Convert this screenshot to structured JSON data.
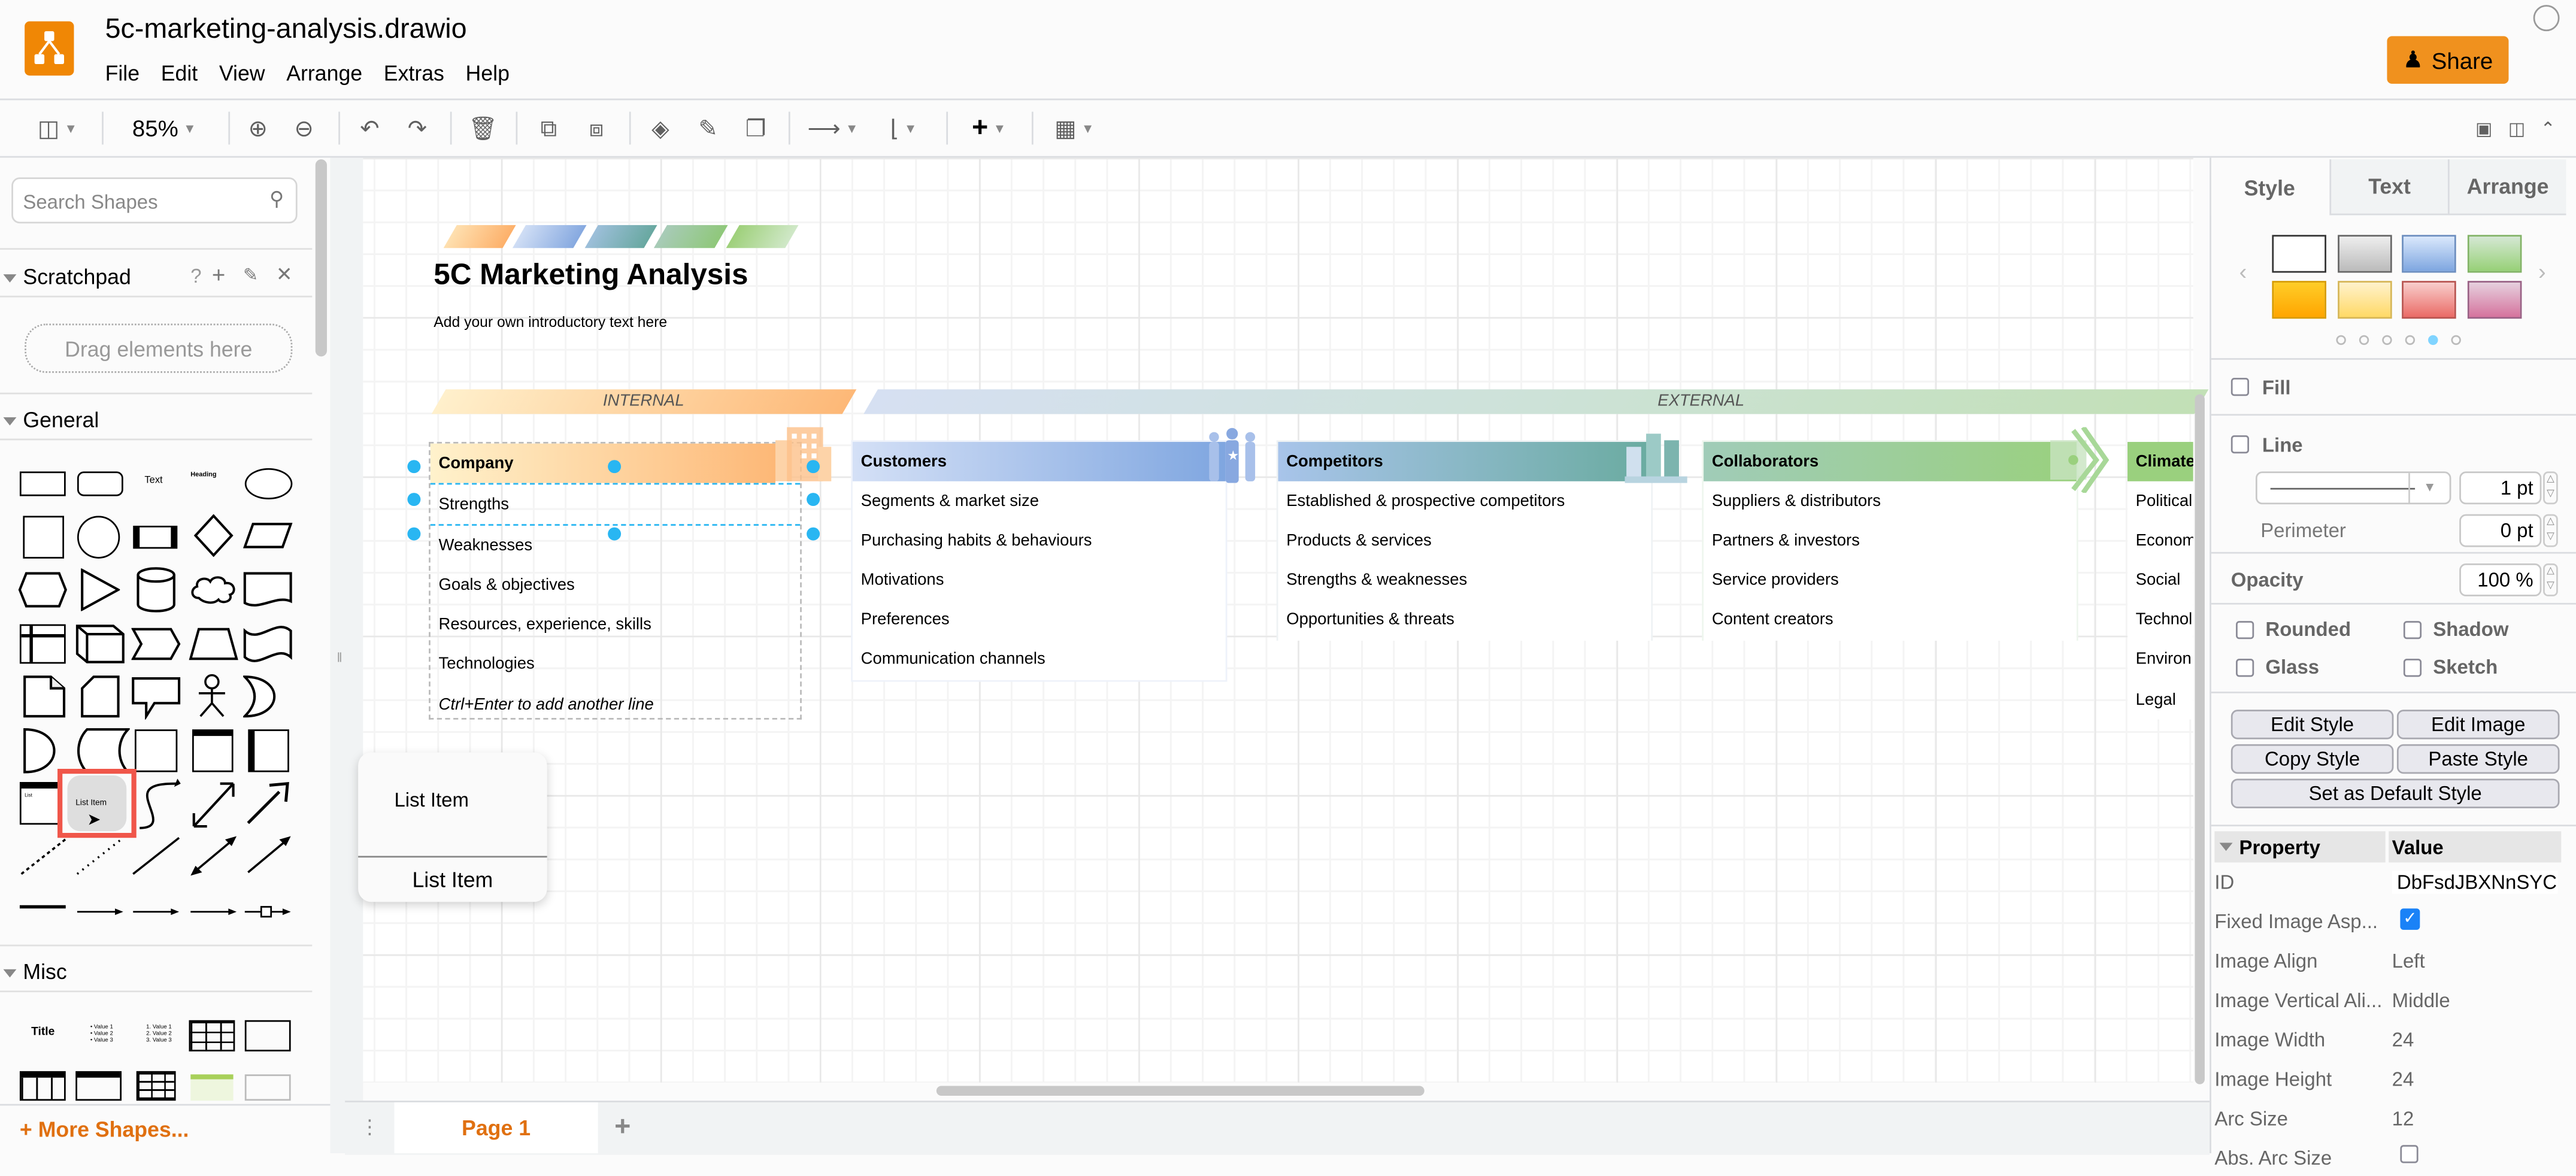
{
  "app": {
    "file_title": "5c-marketing-analysis.drawio",
    "menu": [
      "File",
      "Edit",
      "View",
      "Arrange",
      "Extras",
      "Help"
    ],
    "share_label": "Share",
    "brand_color": "#f08705"
  },
  "toolbar": {
    "zoom": "85%",
    "icons": [
      "format-panel-icon",
      "zoom-in-icon",
      "zoom-out-icon",
      "undo-icon",
      "redo-icon",
      "delete-icon",
      "to-front-icon",
      "to-back-icon",
      "fill-color-icon",
      "line-color-icon",
      "shadow-icon",
      "connection-icon",
      "waypoints-icon",
      "insert-icon",
      "table-icon",
      "fullscreen-icon",
      "toggle-panel-icon",
      "collapse-icon"
    ]
  },
  "sidebar": {
    "search_placeholder": "Search Shapes",
    "scratchpad": {
      "title": "Scratchpad",
      "drop_hint": "Drag elements here",
      "actions": [
        "?",
        "+"
      ]
    },
    "general_title": "General",
    "misc_title": "Misc",
    "shape_text_label": "Text",
    "shape_heading_label": "Heading",
    "list_label": "List",
    "list_item_label": "List Item",
    "misc_title_shape": "Title",
    "more_shapes": "More Shapes..."
  },
  "diagram": {
    "title": "5C Marketing Analysis",
    "intro": "Add your own introductory text here",
    "internal_label": "INTERNAL",
    "external_label": "EXTERNAL",
    "columns": [
      {
        "name": "Company",
        "items": [
          "Strengths",
          "Weaknesses",
          "Goals & objectives",
          "Resources, experience, skills",
          "Technologies"
        ],
        "hint": "Ctrl+Enter to add another line"
      },
      {
        "name": "Customers",
        "items": [
          "Segments & market size",
          "Purchasing habits & behaviours",
          "Motivations",
          "Preferences",
          "Communication channels"
        ]
      },
      {
        "name": "Competitors",
        "items": [
          "Established & prospective competitors",
          "Products & services",
          "Strengths & weaknesses",
          "Opportunities & threats"
        ]
      },
      {
        "name": "Collaborators",
        "items": [
          "Suppliers & distributors",
          "Partners & investors",
          "Service providers",
          "Content creators"
        ]
      },
      {
        "name": "Climate",
        "items": [
          "Political",
          "Econom",
          "Social",
          "Technol",
          "Environ",
          "Legal"
        ]
      }
    ]
  },
  "drag_preview": {
    "top_label": "List Item",
    "bottom_label": "List Item"
  },
  "pages": {
    "current": "Page 1"
  },
  "format_panel": {
    "tabs": [
      "Style",
      "Text",
      "Arrange"
    ],
    "active_tab": "Style",
    "fill_label": "Fill",
    "line_label": "Line",
    "line_width": "1 pt",
    "perimeter_label": "Perimeter",
    "perimeter_value": "0 pt",
    "opacity_label": "Opacity",
    "opacity_value": "100 %",
    "checks": [
      "Rounded",
      "Shadow",
      "Glass",
      "Sketch"
    ],
    "buttons": {
      "edit_style": "Edit Style",
      "edit_image": "Edit Image",
      "copy_style": "Copy Style",
      "paste_style": "Paste Style",
      "set_default": "Set as Default Style"
    },
    "swatch_page": 5,
    "swatch_pages": 6
  },
  "properties": {
    "header_property": "Property",
    "header_value": "Value",
    "rows": [
      {
        "key": "ID",
        "value": "DbFsdJBXNnSYC"
      },
      {
        "key": "Fixed Image Asp...",
        "value": "checked"
      },
      {
        "key": "Image Align",
        "value": "Left"
      },
      {
        "key": "Image Vertical Ali...",
        "value": "Middle"
      },
      {
        "key": "Image Width",
        "value": "24"
      },
      {
        "key": "Image Height",
        "value": "24"
      },
      {
        "key": "Arc Size",
        "value": "12"
      },
      {
        "key": "Abs. Arc Size",
        "value": ""
      }
    ]
  }
}
